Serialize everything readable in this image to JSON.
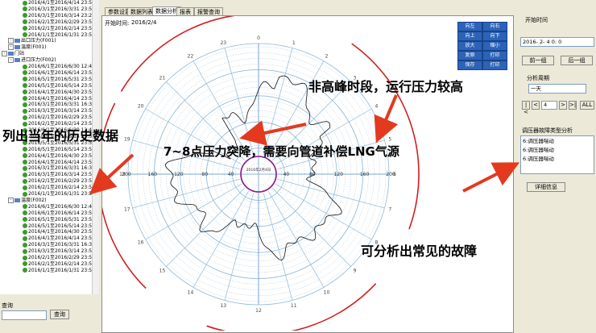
{
  "tree": {
    "group1_dates": [
      "2016/4/1至2016/4/14 23:55",
      "2016/3/1至2016/3/31 23:5",
      "2016/3/1至2016/3/14 23:20",
      "2016/2/1至2016/2/29 23:59",
      "2016/2/1至2016/2/14 23:55",
      "2016/1/1至2016/1/31 23:5"
    ],
    "outlet_pressure": "出口压力(F001)",
    "temperature1": "温度(F001)",
    "station": "门站",
    "inlet_pressure": "进口压力(F002)",
    "group2_dates": [
      "2016/6/1至2016/6/30 12:4",
      "2016/6/1至2016/6/14 23:5",
      "2016/5/1至2016/5/31 23:5",
      "2016/5/1至2016/5/14 23:5",
      "2016/4/1至2016/4/30 23:5",
      "2016/4/1至2016/4/14 23:5",
      "2016/3/1至2016/3/31 16:3",
      "2016/3/1至2016/3/14 23:5",
      "2016/2/1至2016/2/29 23:5",
      "2016/2/1至2016/2/14 23:5"
    ],
    "group3_dates": [
      "2016/6/1至2016/6/30 12:4",
      "2016/6/1至2016/6/14 23:5",
      "2016/5/1至2016/5/31 23:5",
      "2016/5/1至2016/5/14 23:5",
      "2016/4/1至2016/4/30 23:5",
      "2016/4/1至2016/4/14 23:5",
      "2016/3/1至2016/3/31 16:3",
      "2016/3/1至2016/3/14 23:5",
      "2016/2/1至2016/2/29 23:5",
      "2016/2/1至2016/2/14 23:5",
      "2016/1/1至2016/1/31 23:5"
    ],
    "temperature2": "温度(F002)",
    "group4_dates": [
      "2016/6/1至2016/6/30 12:4",
      "2016/6/1至2016/6/14 23:5",
      "2016/5/1至2016/5/31 23:5",
      "2016/5/1至2016/5/14 23:5",
      "2016/4/1至2016/4/30 23:5",
      "2016/4/1至2016/4/14 23:5",
      "2016/3/1至2016/3/31 16:3",
      "2016/3/1至2016/3/14 23:5",
      "2016/2/1至2016/2/29 23:5",
      "2016/2/1至2016/2/14 23:5",
      "2016/1/1至2016/1/31 23:5"
    ]
  },
  "bottom": {
    "label": "查询",
    "button": "查询"
  },
  "tabs": [
    "参数设置",
    "数据列表",
    "数据分析",
    "报表",
    "报警查询"
  ],
  "main": {
    "start_label": "开始时间:",
    "start_value": "2016/2/4",
    "center_label": "2016年2月4日"
  },
  "nav": {
    "up_left": "向左",
    "up_right": "向右",
    "up": "向上",
    "back": "向下",
    "zoom_in": "放大",
    "zoom_out": "缩小",
    "r_up": "复原",
    "r_down": "打印",
    "btn7": "保存",
    "btn8": "打印"
  },
  "chart_ticks": {
    "left": [
      "200",
      "160",
      "120",
      "80",
      "40"
    ],
    "right": [
      "40",
      "80",
      "120",
      "160",
      "200"
    ],
    "hours": [
      "0",
      "1",
      "2",
      "3",
      "4",
      "5",
      "6",
      "7",
      "8",
      "9",
      "10",
      "11",
      "12",
      "13",
      "14",
      "15",
      "16",
      "17",
      "18",
      "19",
      "20",
      "21",
      "22",
      "23"
    ]
  },
  "right": {
    "start_time_label": "开始时间",
    "start_time_value": "2016- 2- 4  0: 0",
    "prev_btn": "前一组",
    "next_btn": "后一组",
    "cycle_label": "分析周期",
    "cycle_value": "一天",
    "page_value": "4",
    "all_btn": "ALL",
    "fault_label": "调压器故障类型分析",
    "faults": [
      "6:调压器喘动",
      "6:调压器喘动",
      "6:调压器喘动"
    ],
    "detail_btn": "详细信息"
  },
  "annotations": {
    "a1": "非高峰时段，运行压力较高",
    "a2": "列出当年的历史数据",
    "a3": "7~8点压力突降，需要向管道补偿LNG气源",
    "a4": "可分析出常见的故障"
  },
  "colors": {
    "grid": "#8fb8d8",
    "red_arc": "#d21e1e",
    "purple": "#8a1c8a",
    "arrow": "#e33a1f"
  }
}
